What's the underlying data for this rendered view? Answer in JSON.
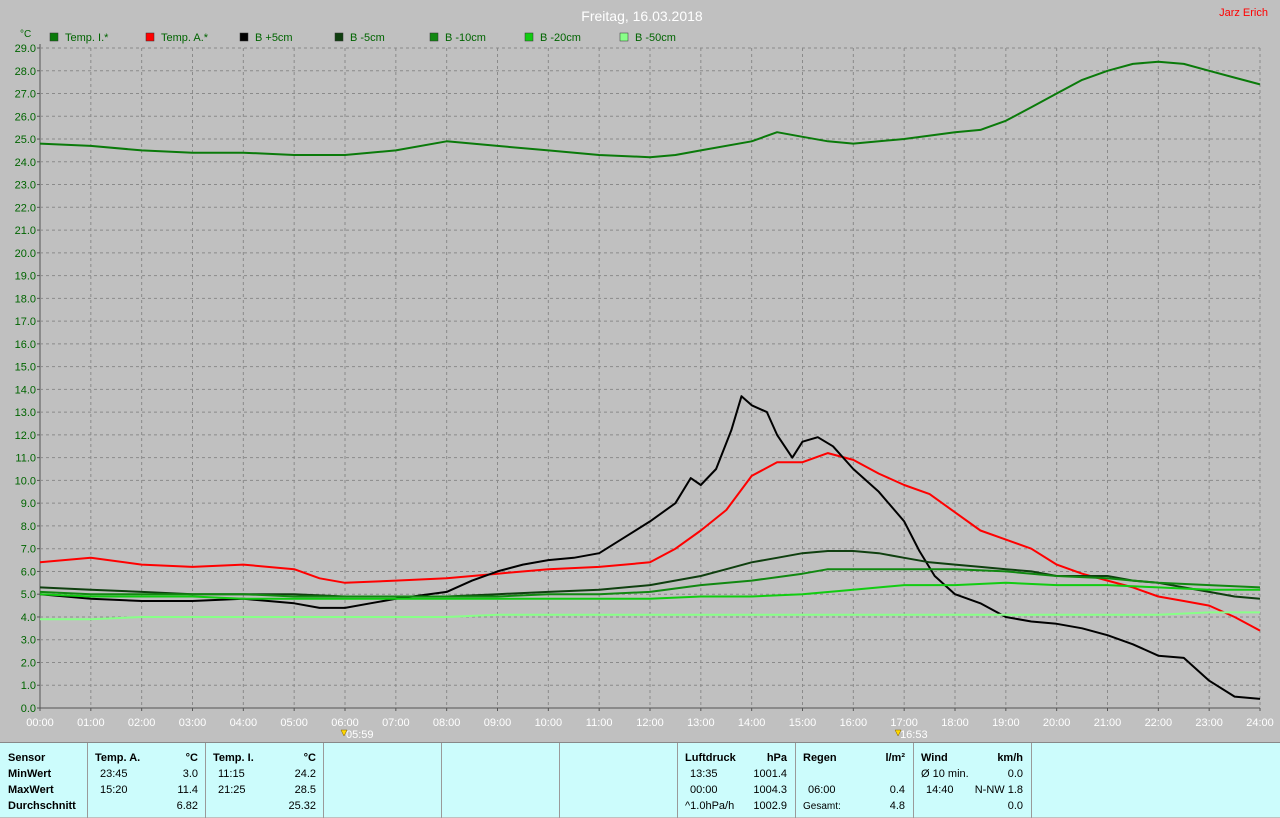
{
  "title": "Freitag, 16.03.2018",
  "author": "Jarz Erich",
  "unit": "°C",
  "chart_data": {
    "type": "line",
    "x_ticks": [
      "00:00",
      "01:00",
      "02:00",
      "03:00",
      "04:00",
      "05:00",
      "06:00",
      "07:00",
      "08:00",
      "09:00",
      "10:00",
      "11:00",
      "12:00",
      "13:00",
      "14:00",
      "15:00",
      "16:00",
      "17:00",
      "18:00",
      "19:00",
      "20:00",
      "21:00",
      "22:00",
      "23:00",
      "24:00"
    ],
    "y_ticks": [
      "0.0",
      "1.0",
      "2.0",
      "3.0",
      "4.0",
      "5.0",
      "6.0",
      "7.0",
      "8.0",
      "9.0",
      "10.0",
      "11.0",
      "12.0",
      "13.0",
      "14.0",
      "15.0",
      "16.0",
      "17.0",
      "18.0",
      "19.0",
      "20.0",
      "21.0",
      "22.0",
      "23.0",
      "24.0",
      "25.0",
      "26.0",
      "27.0",
      "28.0",
      "29.0"
    ],
    "ylim": [
      0,
      29
    ],
    "xlim": [
      0,
      24
    ],
    "grid": true,
    "legend_position": "top-left",
    "markers": [
      {
        "label": "05:59",
        "x": 5.98
      },
      {
        "label": "16:53",
        "x": 16.88
      }
    ],
    "series": [
      {
        "name": "Temp. I.*",
        "color": "#0a7a0a",
        "x": [
          0,
          1,
          2,
          3,
          4,
          5,
          6,
          7,
          8,
          9,
          10,
          11,
          12,
          12.5,
          13,
          14,
          14.5,
          15,
          15.5,
          16,
          17,
          18,
          18.5,
          19,
          19.5,
          20,
          20.5,
          21,
          21.5,
          22,
          22.5,
          23,
          23.5,
          24
        ],
        "y": [
          24.8,
          24.7,
          24.5,
          24.4,
          24.4,
          24.3,
          24.3,
          24.5,
          24.9,
          24.7,
          24.5,
          24.3,
          24.2,
          24.3,
          24.5,
          24.9,
          25.3,
          25.1,
          24.9,
          24.8,
          25.0,
          25.3,
          25.4,
          25.8,
          26.4,
          27.0,
          27.6,
          28.0,
          28.3,
          28.4,
          28.3,
          28.0,
          27.7,
          27.4
        ]
      },
      {
        "name": "Temp. A.*",
        "color": "#ff0000",
        "x": [
          0,
          1,
          2,
          3,
          4,
          5,
          5.5,
          6,
          7,
          8,
          9,
          10,
          11,
          12,
          12.5,
          13,
          13.5,
          14,
          14.5,
          15,
          15.5,
          16,
          16.5,
          17,
          17.5,
          18,
          18.5,
          19,
          19.5,
          20,
          20.5,
          21,
          21.5,
          22,
          22.5,
          23,
          23.5,
          24
        ],
        "y": [
          6.4,
          6.6,
          6.3,
          6.2,
          6.3,
          6.1,
          5.7,
          5.5,
          5.6,
          5.7,
          5.9,
          6.1,
          6.2,
          6.4,
          7.0,
          7.8,
          8.7,
          10.2,
          10.8,
          10.8,
          11.2,
          10.9,
          10.3,
          9.8,
          9.4,
          8.6,
          7.8,
          7.4,
          7.0,
          6.3,
          5.9,
          5.6,
          5.3,
          4.9,
          4.7,
          4.5,
          4.0,
          3.4
        ]
      },
      {
        "name": "B +5cm",
        "color": "#000000",
        "x": [
          0,
          1,
          2,
          3,
          4,
          5,
          5.5,
          6,
          6.5,
          7,
          8,
          8.5,
          9,
          9.5,
          10,
          10.5,
          11,
          11.5,
          12,
          12.5,
          12.8,
          13,
          13.3,
          13.6,
          13.8,
          14,
          14.3,
          14.5,
          14.8,
          15,
          15.3,
          15.6,
          16,
          16.5,
          17,
          17.3,
          17.6,
          18,
          18.5,
          19,
          19.5,
          20,
          20.5,
          21,
          21.5,
          22,
          22.5,
          23,
          23.5,
          24
        ],
        "y": [
          5.0,
          4.8,
          4.7,
          4.7,
          4.8,
          4.6,
          4.4,
          4.4,
          4.6,
          4.8,
          5.1,
          5.6,
          6.0,
          6.3,
          6.5,
          6.6,
          6.8,
          7.5,
          8.2,
          9.0,
          10.1,
          9.8,
          10.5,
          12.2,
          13.7,
          13.3,
          13.0,
          12.0,
          11.0,
          11.7,
          11.9,
          11.5,
          10.5,
          9.5,
          8.2,
          6.9,
          5.8,
          5.0,
          4.6,
          4.0,
          3.8,
          3.7,
          3.5,
          3.2,
          2.8,
          2.3,
          2.2,
          1.2,
          0.5,
          0.4
        ]
      },
      {
        "name": "B -5cm",
        "color": "#0f3f0f",
        "x": [
          0,
          1,
          2,
          3,
          4,
          5,
          6,
          7,
          8,
          9,
          10,
          11,
          12,
          13,
          13.5,
          14,
          14.5,
          15,
          15.5,
          16,
          16.5,
          17,
          17.5,
          18,
          18.5,
          19,
          19.5,
          20,
          20.5,
          21,
          21.5,
          22,
          22.5,
          23,
          23.5,
          24
        ],
        "y": [
          5.3,
          5.2,
          5.1,
          5.0,
          5.0,
          5.0,
          4.9,
          4.9,
          4.9,
          5.0,
          5.1,
          5.2,
          5.4,
          5.8,
          6.1,
          6.4,
          6.6,
          6.8,
          6.9,
          6.9,
          6.8,
          6.6,
          6.4,
          6.3,
          6.2,
          6.1,
          6.0,
          5.8,
          5.8,
          5.8,
          5.6,
          5.5,
          5.3,
          5.1,
          4.9,
          4.8
        ]
      },
      {
        "name": "B -10cm",
        "color": "#118811",
        "x": [
          0,
          1,
          2,
          3,
          4,
          5,
          6,
          7,
          8,
          9,
          10,
          11,
          12,
          13,
          14,
          15,
          15.5,
          16,
          17,
          18,
          19,
          20,
          21,
          21.5,
          22,
          23,
          24
        ],
        "y": [
          5.1,
          5.0,
          5.0,
          5.0,
          5.0,
          4.9,
          4.9,
          4.9,
          4.9,
          4.9,
          5.0,
          5.0,
          5.1,
          5.4,
          5.6,
          5.9,
          6.1,
          6.1,
          6.1,
          6.1,
          6.0,
          5.8,
          5.7,
          5.6,
          5.5,
          5.4,
          5.3
        ]
      },
      {
        "name": "B -20cm",
        "color": "#11cc11",
        "x": [
          0,
          1,
          2,
          3,
          4,
          5,
          6,
          7,
          8,
          9,
          10,
          11,
          12,
          13,
          14,
          15,
          16,
          17,
          18,
          19,
          20,
          21,
          22,
          23,
          24
        ],
        "y": [
          5.0,
          4.9,
          4.9,
          4.9,
          4.8,
          4.8,
          4.8,
          4.8,
          4.8,
          4.8,
          4.8,
          4.8,
          4.8,
          4.9,
          4.9,
          5.0,
          5.2,
          5.4,
          5.4,
          5.5,
          5.4,
          5.4,
          5.3,
          5.2,
          5.2
        ]
      },
      {
        "name": "B -50cm",
        "color": "#88ff88",
        "x": [
          0,
          1,
          2,
          3,
          4,
          5,
          6,
          7,
          8,
          9,
          10,
          11,
          12,
          13,
          14,
          15,
          16,
          17,
          18,
          19,
          20,
          21,
          22,
          23,
          24
        ],
        "y": [
          3.9,
          3.9,
          4.0,
          4.0,
          4.0,
          4.0,
          4.0,
          4.0,
          4.0,
          4.1,
          4.1,
          4.1,
          4.1,
          4.1,
          4.1,
          4.1,
          4.1,
          4.1,
          4.1,
          4.1,
          4.1,
          4.1,
          4.1,
          4.2,
          4.2
        ]
      }
    ]
  },
  "stats": {
    "sensor": {
      "header": "Sensor",
      "rows": [
        "MinWert",
        "MaxWert",
        "Durchschnitt"
      ]
    },
    "temp_a": {
      "header": "Temp. A.",
      "unit": "°C",
      "min_time": "23:45",
      "min_val": "3.0",
      "max_time": "15:20",
      "max_val": "11.4",
      "avg": "6.82"
    },
    "temp_i": {
      "header": "Temp. I.",
      "unit": "°C",
      "min_time": "11:15",
      "min_val": "24.2",
      "max_time": "21:25",
      "max_val": "28.5",
      "avg": "25.32"
    },
    "luftdruck": {
      "header": "Luftdruck",
      "unit": "hPa",
      "min_time": "13:35",
      "min_val": "1001.4",
      "max_time": "00:00",
      "max_val": "1004.3",
      "trend_label": "^1.0hPa/h",
      "trend_val": "1002.9"
    },
    "regen": {
      "header": "Regen",
      "unit": "l/m²",
      "time": "06:00",
      "val": "0.4",
      "total_label": "Gesamt:",
      "total_val": "4.8"
    },
    "wind": {
      "header": "Wind",
      "unit": "km/h",
      "avg_label": "Ø 10 min.",
      "avg_val": "0.0",
      "max_time": "14:40",
      "max_val": "N-NW 1.8",
      "third_val": "0.0"
    }
  }
}
